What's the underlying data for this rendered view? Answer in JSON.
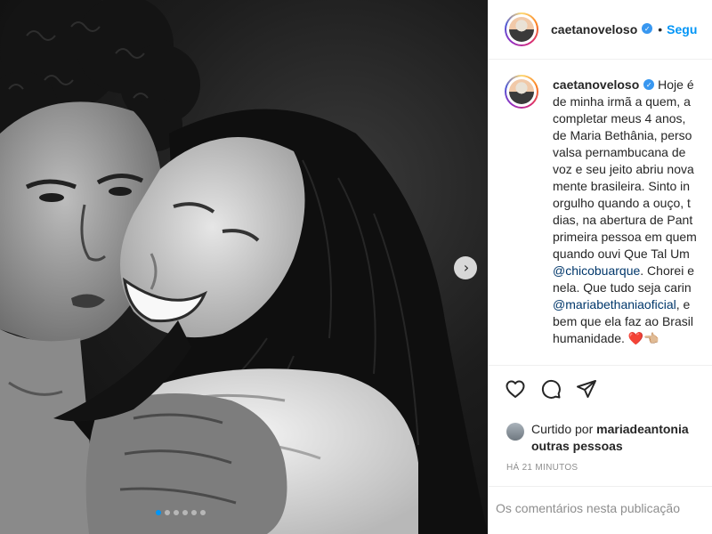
{
  "post": {
    "next_symbol": "›",
    "carousel": {
      "count": 6,
      "active": 0
    }
  },
  "header": {
    "username": "caetanoveloso",
    "verified_mark": "✓",
    "separator": "•",
    "follow_label": "Segu"
  },
  "caption": {
    "username": "caetanoveloso",
    "lines": [
      {
        "text": "Hoje é"
      },
      {
        "text": "de minha irmã a quem, a"
      },
      {
        "text": "completar meus 4 anos,"
      },
      {
        "text": "de Maria Bethânia, perso"
      },
      {
        "text": "valsa pernambucana de"
      },
      {
        "text": "voz e seu jeito abriu nova"
      },
      {
        "text": "mente brasileira. Sinto in"
      },
      {
        "text": "orgulho quando a ouço, t"
      },
      {
        "text": "dias, na abertura de Pant"
      },
      {
        "text": "primeira pessoa em quem"
      },
      {
        "text": "quando ouvi Que Tal Um"
      },
      {
        "mention": "@chicobuarque",
        "text": ". Chorei e"
      },
      {
        "text": "nela. Que tudo seja carin"
      },
      {
        "mention": "@mariabethaniaoficial",
        "text": ", e"
      },
      {
        "text": "bem que ela faz ao Brasil"
      },
      {
        "text": "humanidade. ",
        "heart": "❤️",
        "hand": "👈🏼"
      }
    ]
  },
  "actions": {
    "like_icon": "heart-outline",
    "comment_icon": "comment-bubble",
    "share_icon": "paper-plane"
  },
  "likes": {
    "prefix": "Curtido por ",
    "user": "mariadeantonia",
    "suffix": "outras pessoas"
  },
  "timestamp": "HÁ 21 MINUTOS",
  "comments_note": "Os comentários nesta publicação"
}
